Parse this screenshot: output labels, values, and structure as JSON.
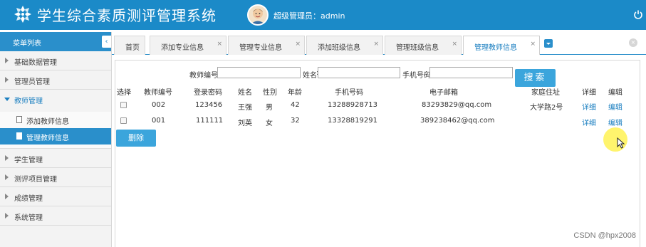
{
  "header": {
    "title": "学生综合素质测评管理系统",
    "user_label": "超级管理员：admin",
    "logo_icon": "snowflake-logo-icon",
    "power_icon": "power-icon",
    "bg_color": "#1b8ac8"
  },
  "sidebar": {
    "title": "菜单列表",
    "collapse_glyph": "‹",
    "items": [
      {
        "label": "基础数据管理"
      },
      {
        "label": "管理员管理"
      },
      {
        "label": "教师管理"
      },
      {
        "label": "学生管理"
      },
      {
        "label": "测评项目管理"
      },
      {
        "label": "成绩管理"
      },
      {
        "label": "系统管理"
      }
    ],
    "sub_items": [
      {
        "label": "添加教师信息"
      },
      {
        "label": "管理教师信息"
      }
    ],
    "active_sub": "管理教师信息"
  },
  "tabs": {
    "items": [
      {
        "label": "首页"
      },
      {
        "label": "添加专业信息"
      },
      {
        "label": "管理专业信息"
      },
      {
        "label": "添加班级信息"
      },
      {
        "label": "管理班级信息"
      },
      {
        "label": "管理教师信息"
      }
    ],
    "close_glyph": "×",
    "close_all_glyph": "×"
  },
  "search": {
    "teacher_id_label": "教师编号",
    "name_label": "姓名",
    "phone_label": "手机号码",
    "teacher_id_value": "",
    "name_value": "",
    "phone_value": "",
    "button_label": "搜索"
  },
  "table": {
    "headers": [
      "选择",
      "教师编号",
      "登录密码",
      "姓名",
      "性别",
      "年龄",
      "手机号码",
      "电子邮箱",
      "家庭住址",
      "详细",
      "编辑"
    ],
    "rows": [
      {
        "id": "002",
        "password": "123456",
        "name": "王强",
        "gender": "男",
        "age": "42",
        "phone": "13288928713",
        "email": "83293829@qq.com",
        "address": "大学路2号",
        "detail": "详细",
        "edit": "编辑"
      },
      {
        "id": "001",
        "password": "111111",
        "name": "刘英",
        "gender": "女",
        "age": "32",
        "phone": "13328819291",
        "email": "389238462@qq.com",
        "address": "",
        "detail": "详细",
        "edit": "编辑"
      }
    ]
  },
  "actions": {
    "delete_label": "删除"
  },
  "watermark": "CSDN @hpx2008"
}
